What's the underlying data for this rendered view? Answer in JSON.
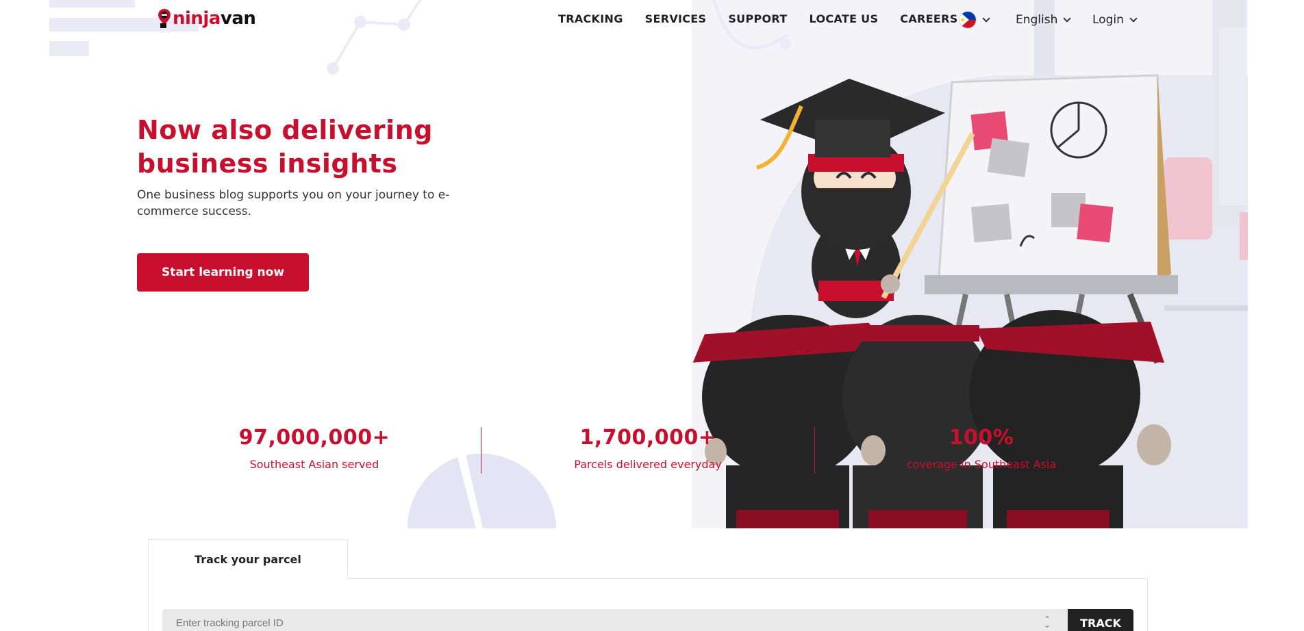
{
  "brand": {
    "logo_part1": "ninja",
    "logo_part2": "van",
    "accent_color": "#c8102e",
    "dark_color": "#212121"
  },
  "nav": {
    "items": [
      {
        "label": "TRACKING"
      },
      {
        "label": "SERVICES"
      },
      {
        "label": "SUPPORT"
      },
      {
        "label": "LOCATE US"
      },
      {
        "label": "CAREERS"
      }
    ],
    "country_flag": "philippines-flag-icon",
    "language": "English",
    "login": "Login"
  },
  "hero": {
    "title_line1": "Now also delivering",
    "title_line2": "business insights",
    "subtitle": "One business blog supports you on your journey to e-commerce success.",
    "cta_label": "Start learning now",
    "illustration": "ninja-teacher-illustration"
  },
  "stats": [
    {
      "value": "97,000,000+",
      "label": "Southeast Asian served"
    },
    {
      "value": "1,700,000+",
      "label": "Parcels delivered everyday"
    },
    {
      "value": "100%",
      "label": "coverage in Southeast Asia"
    }
  ],
  "tracking": {
    "tab_label": "Track your parcel",
    "input_placeholder": "Enter tracking parcel ID",
    "button_label": "TRACK"
  }
}
